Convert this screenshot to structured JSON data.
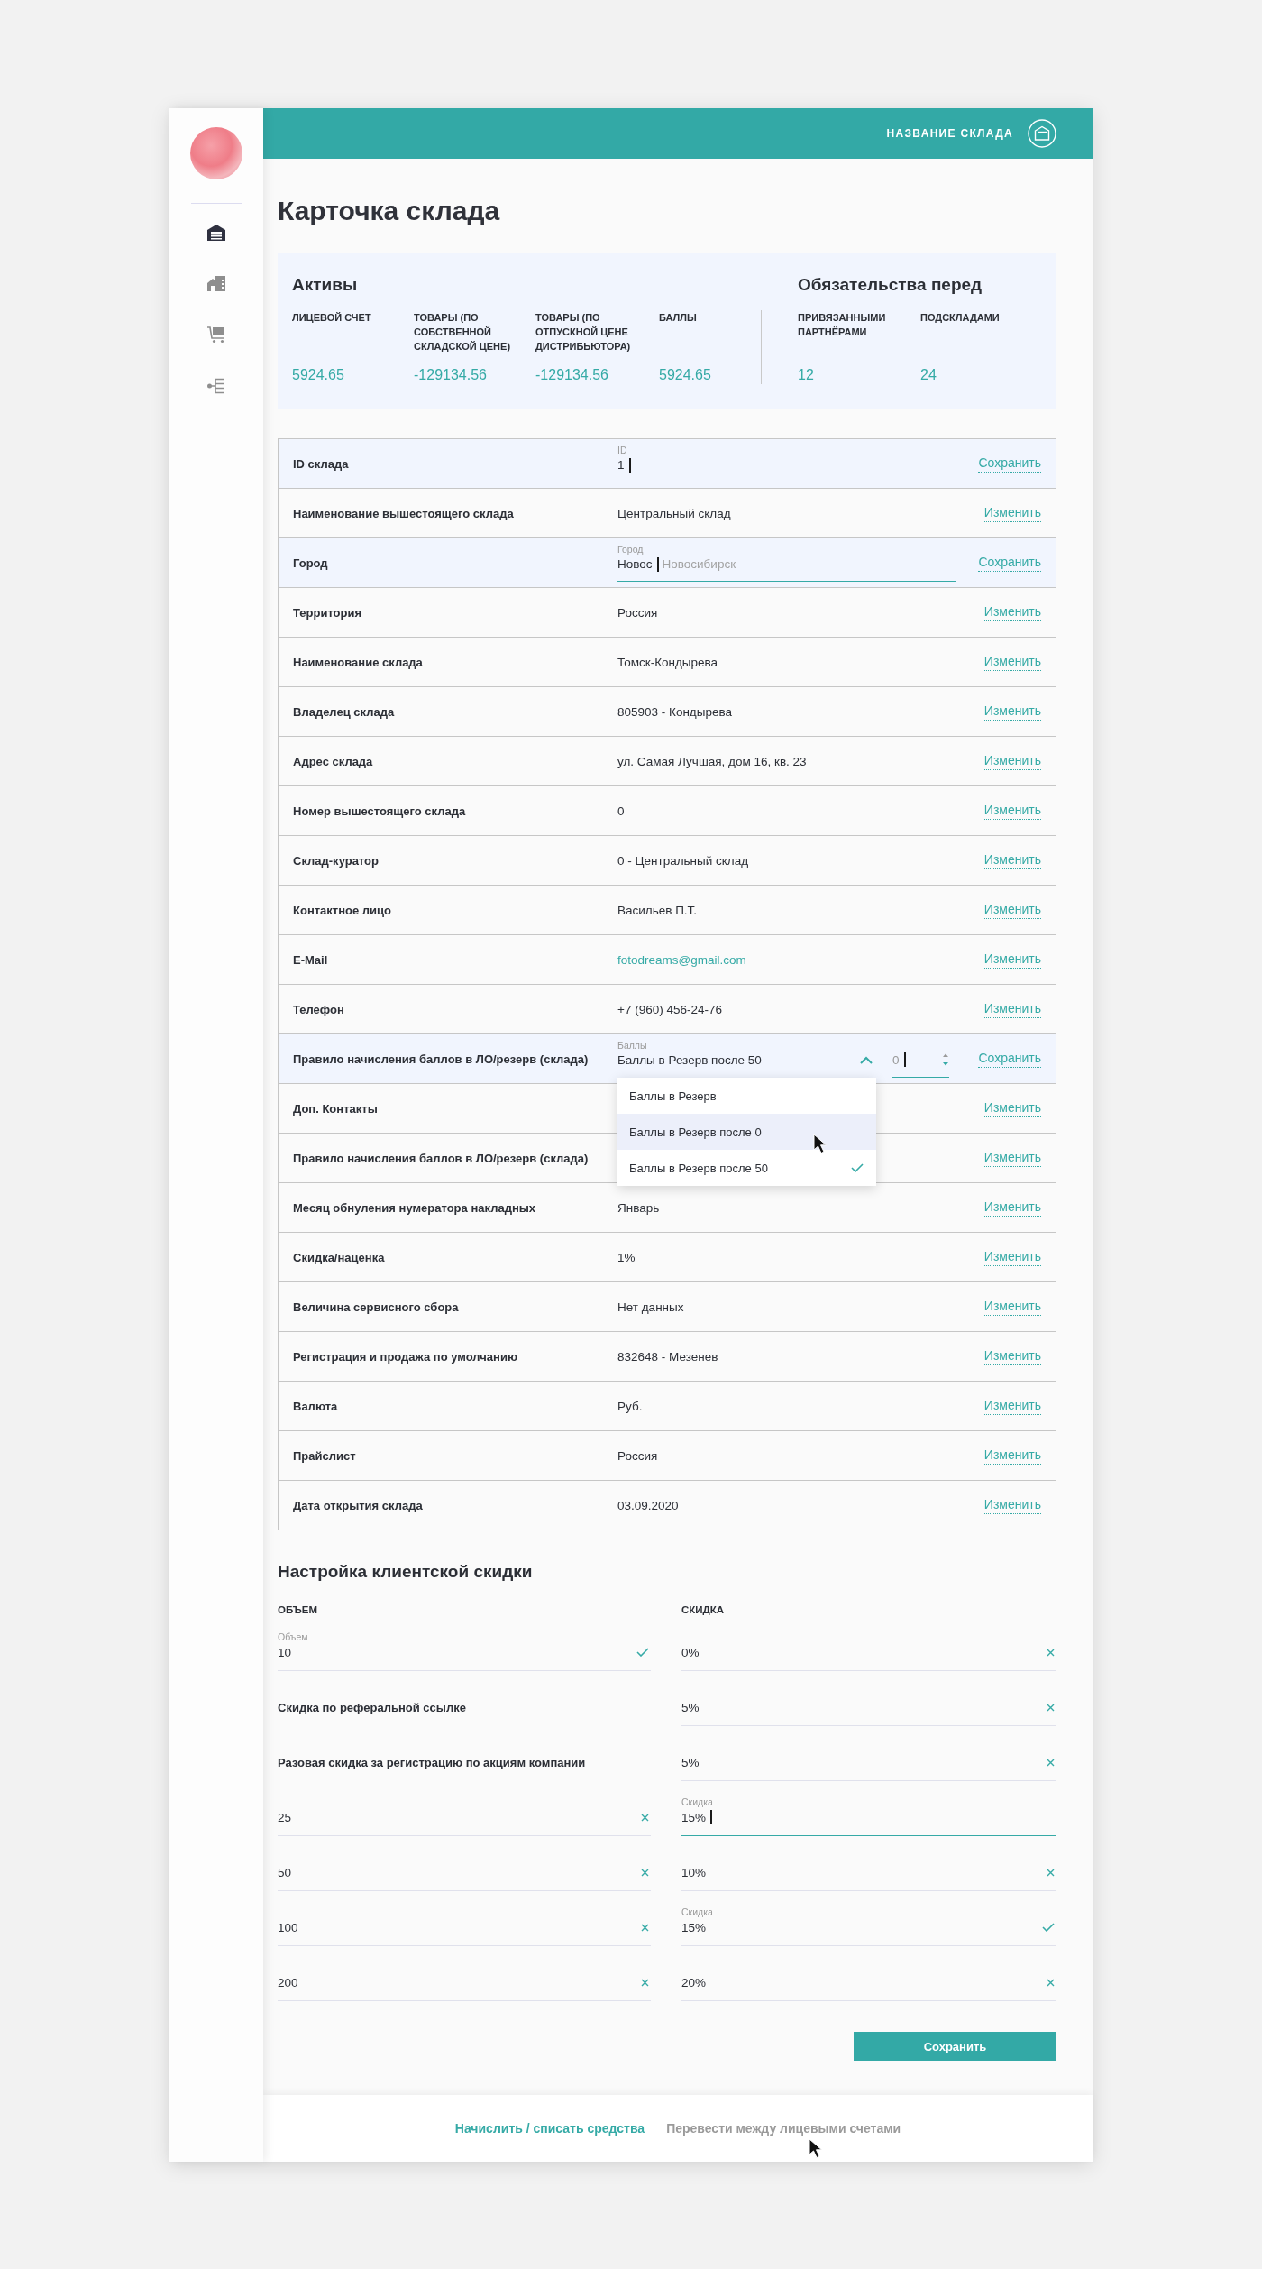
{
  "sidebar": {
    "items": [
      {
        "selected": true
      },
      {
        "selected": false
      },
      {
        "selected": false
      },
      {
        "selected": false
      }
    ]
  },
  "header": {
    "title": "НАЗВАНИЕ СКЛАДА"
  },
  "page_title": "Карточка склада",
  "summary": {
    "groups": [
      {
        "title": "Активы",
        "metrics": [
          {
            "label": "ЛИЦЕВОЙ СЧЕТ",
            "value": "5924.65"
          },
          {
            "label": "ТОВАРЫ (ПО СОБСТВЕННОЙ СКЛАДСКОЙ ЦЕНЕ)",
            "value": "-129134.56"
          },
          {
            "label": "ТОВАРЫ (ПО ОТПУСКНОЙ ЦЕНЕ ДИСТРИБЬЮТОРА)",
            "value": "-129134.56"
          },
          {
            "label": "БАЛЛЫ",
            "value": "5924.65"
          }
        ]
      },
      {
        "title": "Обязательства перед",
        "metrics": [
          {
            "label": "ПРИВЯЗАННЫМИ ПАРТНЁРАМИ",
            "value": "12"
          },
          {
            "label": "ПОДСКЛАДАМИ",
            "value": "24"
          }
        ]
      }
    ]
  },
  "table": {
    "rows": [
      {
        "kind": "input",
        "label": "ID склада",
        "field_label": "ID",
        "value": "1",
        "action": "Сохранить"
      },
      {
        "kind": "text",
        "label": "Наименование вышестоящего склада",
        "value": "Центральный склад",
        "action": "Изменить"
      },
      {
        "kind": "input",
        "label": "Город",
        "field_label": "Город",
        "value": "Новос",
        "suggestion": "Новосибирск",
        "action": "Сохранить"
      },
      {
        "kind": "text",
        "label": "Территория",
        "value": "Россия",
        "action": "Изменить"
      },
      {
        "kind": "text",
        "label": "Наименование склада",
        "value": "Томск-Кондырева",
        "action": "Изменить"
      },
      {
        "kind": "text",
        "label": "Владелец склада",
        "value": "805903 - Кондырева",
        "action": "Изменить"
      },
      {
        "kind": "text",
        "label": "Адрес склада",
        "value": "ул. Самая Лучшая, дом 16, кв. 23",
        "action": "Изменить"
      },
      {
        "kind": "text",
        "label": "Номер вышестоящего склада",
        "value": "0",
        "action": "Изменить"
      },
      {
        "kind": "text",
        "label": "Склад-куратор",
        "value": "0 - Центральный склад",
        "action": "Изменить"
      },
      {
        "kind": "text",
        "label": "Контактное лицо",
        "value": "Васильев П.Т.",
        "action": "Изменить"
      },
      {
        "kind": "link",
        "label": "E-Mail",
        "value": "fotodreams@gmail.com",
        "action": "Изменить"
      },
      {
        "kind": "text",
        "label": "Телефон",
        "value": "+7 (960) 456-24-76",
        "action": "Изменить"
      },
      {
        "kind": "select",
        "label": "Правило начисления баллов в ЛО/резерв (склада)",
        "field_label": "Баллы",
        "value": "Баллы в Резерв после 50",
        "expanded": true,
        "options": [
          {
            "label": "Баллы в Резерв",
            "selected": false,
            "hovered": false
          },
          {
            "label": "Баллы в Резерв после 0",
            "selected": false,
            "hovered": true
          },
          {
            "label": "Баллы в Резерв после 50",
            "selected": true,
            "hovered": false
          }
        ],
        "amount": "0",
        "action": "Сохранить"
      },
      {
        "kind": "text",
        "label": "Доп. Контакты",
        "action": "Изменить"
      },
      {
        "kind": "text",
        "label": "Правило начисления баллов в ЛО/резерв (склада)",
        "action": "Изменить"
      },
      {
        "kind": "text",
        "label": "Месяц обнуления нумератора накладных",
        "value": "Январь",
        "action": "Изменить"
      },
      {
        "kind": "text",
        "label": "Скидка/наценка",
        "value": "1%",
        "action": "Изменить"
      },
      {
        "kind": "text",
        "label": "Величина сервисного сбора",
        "value": "Нет данных",
        "action": "Изменить"
      },
      {
        "kind": "text",
        "label": "Регистрация и продажа по умолчанию",
        "value": "832648 - Мезенев",
        "action": "Изменить"
      },
      {
        "kind": "text",
        "label": "Валюта",
        "value": "Руб.",
        "action": "Изменить"
      },
      {
        "kind": "text",
        "label": "Прайслист",
        "value": "Россия",
        "action": "Изменить"
      },
      {
        "kind": "text",
        "label": "Дата открытия склада",
        "value": "03.09.2020",
        "action": "Изменить"
      }
    ]
  },
  "discount": {
    "title": "Настройка клиентской скидки",
    "columns": [
      "ОБЪЕМ",
      "СКИДКА"
    ],
    "rows": [
      {
        "volume": {
          "kind": "confirmed",
          "label": "Объем",
          "value": "10"
        },
        "discount": {
          "kind": "clearable",
          "value": "0%"
        }
      },
      {
        "volume": {
          "kind": "text",
          "text": "Скидка по реферальной ссылке"
        },
        "discount": {
          "kind": "clearable",
          "value": "5%"
        }
      },
      {
        "volume": {
          "kind": "text",
          "text": "Разовая скидка за регистрацию по акциям компании"
        },
        "discount": {
          "kind": "clearable",
          "value": "5%"
        }
      },
      {
        "volume": {
          "kind": "clearable",
          "value": "25"
        },
        "discount": {
          "kind": "editing",
          "label": "Скидка",
          "value": "15%"
        }
      },
      {
        "volume": {
          "kind": "clearable",
          "value": "50"
        },
        "discount": {
          "kind": "clearable",
          "value": "10%"
        }
      },
      {
        "volume": {
          "kind": "clearable",
          "value": "100"
        },
        "discount": {
          "kind": "confirmed",
          "label": "Скидка",
          "value": "15%"
        }
      },
      {
        "volume": {
          "kind": "clearable",
          "value": "200"
        },
        "discount": {
          "kind": "clearable",
          "value": "20%"
        }
      }
    ],
    "save_button": "Сохранить"
  },
  "footer": {
    "links": [
      {
        "label": "Начислить / списать средства",
        "selected": true
      },
      {
        "label": "Перевести между лицевыми счетами",
        "selected": false
      }
    ]
  }
}
